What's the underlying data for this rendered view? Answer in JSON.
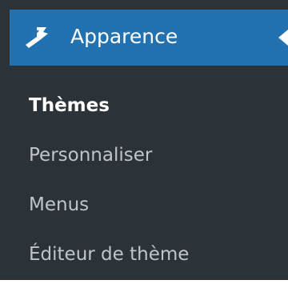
{
  "menu": {
    "header": {
      "title": "Apparence",
      "icon": "paintbrush-icon",
      "colors": {
        "background": "#2271b1",
        "text": "#ffffff"
      }
    },
    "items": [
      {
        "label": "Thèmes",
        "current": true
      },
      {
        "label": "Personnaliser",
        "current": false
      },
      {
        "label": "Menus",
        "current": false
      },
      {
        "label": "Éditeur de thème",
        "current": false
      }
    ],
    "colors": {
      "background": "#2c3338",
      "item_text": "#c3c4c7",
      "current_text": "#ffffff"
    }
  }
}
